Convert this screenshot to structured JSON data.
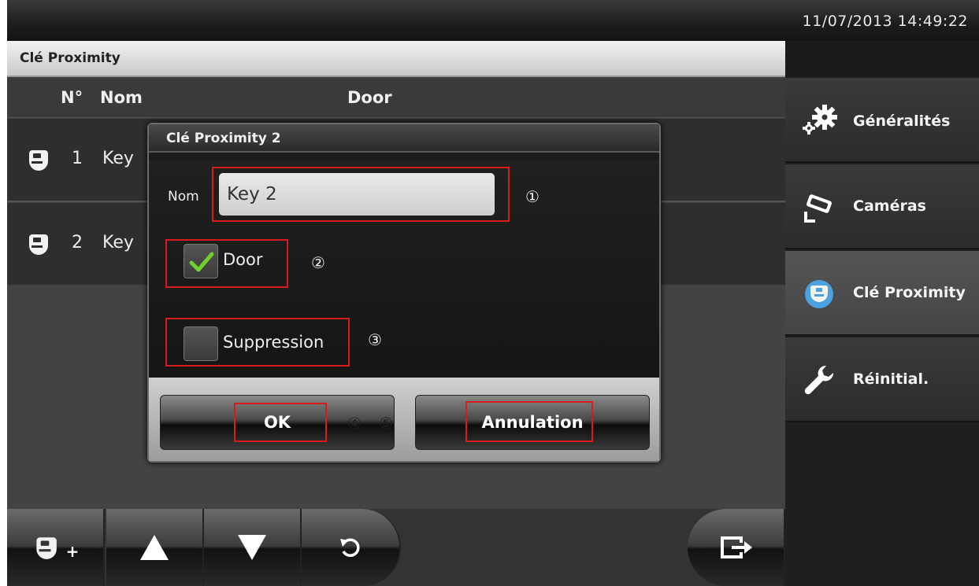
{
  "topbar": {
    "datetime": "11/07/2013 14:49:22"
  },
  "page": {
    "title": "Clé Proximity"
  },
  "columns": {
    "number": "N°",
    "name": "Nom",
    "door": "Door"
  },
  "rows": [
    {
      "number": "1",
      "name": "Key"
    },
    {
      "number": "2",
      "name": "Key"
    }
  ],
  "dialog": {
    "title": "Clé Proximity 2",
    "name_label": "Nom",
    "name_value": "Key 2",
    "door_label": "Door",
    "door_checked": true,
    "suppression_label": "Suppression",
    "suppression_checked": false,
    "ok_label": "OK",
    "cancel_label": "Annulation"
  },
  "markers": {
    "m1": "①",
    "m2": "②",
    "m3": "③",
    "m4": "④",
    "m5": "⑤"
  },
  "sidebar": {
    "items": [
      {
        "label": "Généralités",
        "icon": "gears-icon"
      },
      {
        "label": "Caméras",
        "icon": "camera-icon"
      },
      {
        "label": "Clé Proximity",
        "icon": "proximity-key-icon",
        "active": true
      },
      {
        "label": "Réinitial.",
        "icon": "wrench-icon"
      }
    ]
  },
  "toolbar": {
    "add_plus": "+",
    "buttons": [
      "add-key",
      "move-up",
      "move-down",
      "undo",
      "exit"
    ]
  },
  "colors": {
    "annotation": "#d81b1b",
    "check": "#6fd12a",
    "active_key_icon": "#4aa3e0"
  }
}
